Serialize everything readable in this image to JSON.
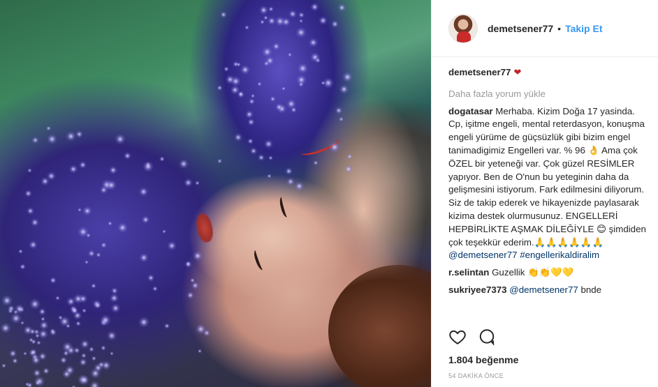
{
  "post": {
    "username": "demetsener77",
    "follow_label": "Takip Et",
    "separator": "•"
  },
  "caption": {
    "username": "demetsener77",
    "emoji": "❤"
  },
  "load_more_label": "Daha fazla yorum yükle",
  "comments": [
    {
      "user": "dogatasar",
      "text": "Merhaba. Kizim Doğa 17 yasinda. Cp, işitme engeli, mental reterdasyon, konuşma engeli yürüme de güçsüzlük gibi bizim engel tanimadigimiz Engelleri var. % 96 👌 Ama çok ÖZEL bir yeteneği var. Çok güzel RESİMLER yapıyor. Ben de O'nun bu yeteginin daha da gelişmesini istiyorum. Fark edilmesini diliyorum. Siz de takip ederek ve hikayenizde paylasarak kizima destek olurmusunuz. ENGELLERİ HEPBİRLİKTE AŞMAK DİLEĞİYLE 😊 şimdiden çok teşekkür ederim.🙏🙏🙏🙏🙏🙏",
      "mention_text": "@demetsener77 #engellerikaldiralim"
    },
    {
      "user": "r.selintan",
      "text": "Guzellik 👏👏💛💛",
      "mention_text": ""
    },
    {
      "user": "sukriyee7373",
      "text": "bnde",
      "mention_text": "@demetsener77"
    }
  ],
  "likes_text": "1.804 beğenme",
  "time_text": "54 DAKİKA ÖNCE",
  "icons": {
    "like": "heart-outline-icon",
    "comment": "speech-bubble-icon"
  },
  "colors": {
    "link_blue": "#3897f0",
    "mention_navy": "#003569",
    "heart_red": "#c4222a"
  }
}
